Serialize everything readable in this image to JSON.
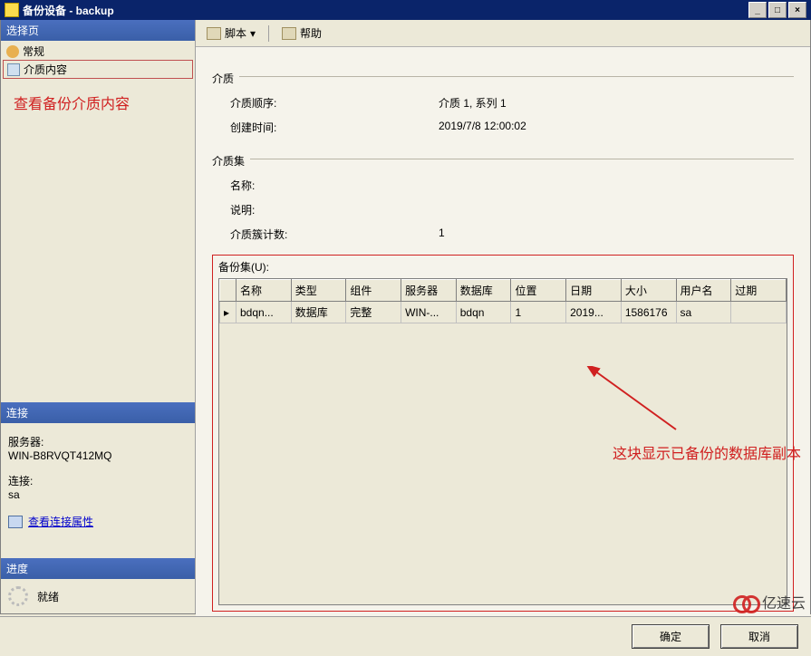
{
  "window": {
    "title": "备份设备 - backup"
  },
  "sidebar": {
    "header": "选择页",
    "items": [
      {
        "label": "常规"
      },
      {
        "label": "介质内容"
      }
    ],
    "annotation": "查看备份介质内容"
  },
  "connection": {
    "header": "连接",
    "server_label": "服务器:",
    "server_value": "WIN-B8RVQT412MQ",
    "conn_label": "连接:",
    "conn_value": "sa",
    "link": "查看连接属性"
  },
  "progress": {
    "header": "进度",
    "status": "就绪"
  },
  "toolbar": {
    "script": "脚本",
    "help": "帮助"
  },
  "media": {
    "section1": "介质",
    "order_label": "介质顺序:",
    "order_value": "介质 1, 系列 1",
    "created_label": "创建时间:",
    "created_value": "2019/7/8 12:00:02",
    "section2": "介质集",
    "name_label": "名称:",
    "name_value": "",
    "desc_label": "说明:",
    "desc_value": "",
    "family_label": "介质簇计数:",
    "family_value": "1"
  },
  "backupset": {
    "label": "备份集(U):",
    "columns": [
      "名称",
      "类型",
      "组件",
      "服务器",
      "数据库",
      "位置",
      "日期",
      "大小",
      "用户名",
      "过期"
    ],
    "rows": [
      [
        "bdqn...",
        "数据库",
        "完整",
        "WIN-...",
        "bdqn",
        "1",
        "2019...",
        "1586176",
        "sa",
        ""
      ]
    ],
    "annotation": "这块显示已备份的数据库副本"
  },
  "buttons": {
    "ok": "确定",
    "cancel": "取消"
  },
  "watermark": "亿速云"
}
